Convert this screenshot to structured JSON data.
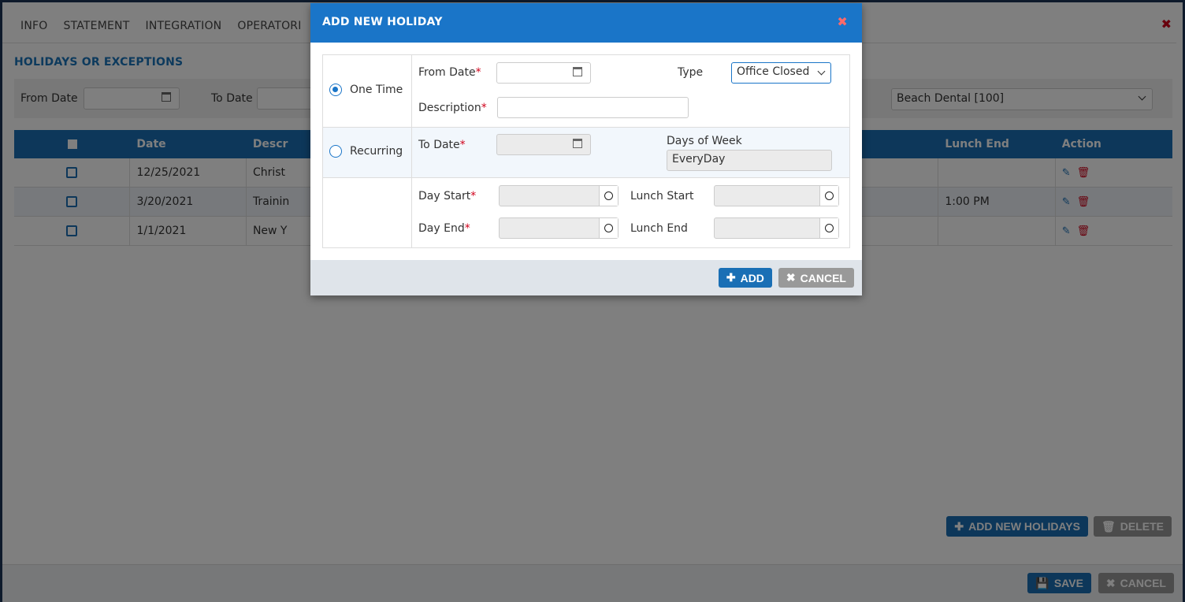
{
  "page": {
    "tabs": [
      "INFO",
      "STATEMENT",
      "INTEGRATION",
      "OPERATORI"
    ],
    "section_title": "HOLIDAYS OR EXCEPTIONS",
    "filter": {
      "from_date_label": "From Date",
      "to_date_label": "To Date",
      "office_select": "Beach Dental [100]"
    },
    "grid": {
      "headers": [
        "",
        "Date",
        "Descr",
        "",
        "Lunch End",
        "Action"
      ],
      "rows": [
        {
          "date": "12/25/2021",
          "description": "Christ",
          "lunch_end": ""
        },
        {
          "date": "3/20/2021",
          "description": "Trainin",
          "lunch_end": "1:00 PM"
        },
        {
          "date": "1/1/2021",
          "description": "New Y",
          "lunch_end": ""
        }
      ]
    },
    "add_new_holidays_label": "ADD NEW HOLIDAYS",
    "delete_label": "DELETE",
    "save_label": "SAVE",
    "cancel_label": "CANCEL"
  },
  "modal": {
    "title": "ADD NEW HOLIDAY",
    "one_time_label": "One Time",
    "recurring_label": "Recurring",
    "from_date_label": "From Date",
    "type_label": "Type",
    "type_value": "Office Closed",
    "description_label": "Description",
    "to_date_label": "To Date",
    "days_of_week_label": "Days of Week",
    "days_of_week_value": "EveryDay",
    "day_start_label": "Day Start",
    "day_end_label": "Day End",
    "lunch_start_label": "Lunch Start",
    "lunch_end_label": "Lunch End",
    "add_label": "ADD",
    "cancel_label": "CANCEL",
    "required_mark": "*"
  },
  "colors": {
    "primary": "#1a75c8",
    "header_blue": "#1a6fb5",
    "required": "#d0021b"
  }
}
